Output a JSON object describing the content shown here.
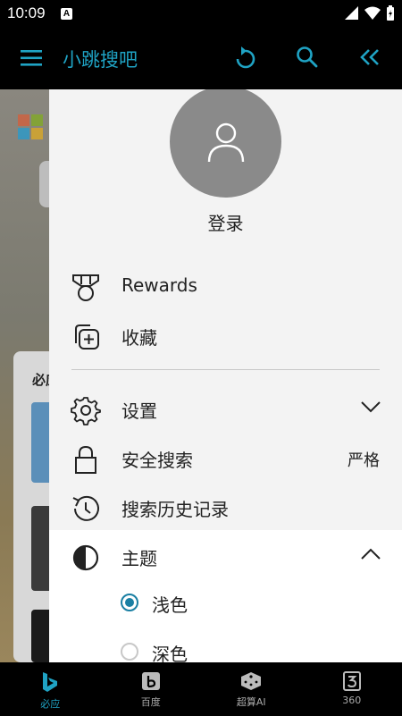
{
  "status": {
    "time": "10:09",
    "notif_icon": "A"
  },
  "appbar": {
    "title": "小跳搜吧",
    "menu_icon": "hamburger-icon",
    "refresh_icon": "refresh-icon",
    "search_icon": "search-icon",
    "collapse_icon": "double-chevron-left-icon",
    "accent": "#1fa3c4"
  },
  "background": {
    "section_label": "必应"
  },
  "drawer": {
    "login_label": "登录",
    "items": {
      "rewards": "Rewards",
      "favorites": "收藏",
      "settings": "设置",
      "safe_search": "安全搜索",
      "safe_search_value": "严格",
      "history": "搜索历史记录",
      "theme": "主题"
    },
    "theme_options": [
      {
        "label": "浅色",
        "selected": true
      },
      {
        "label": "深色",
        "selected": false
      }
    ]
  },
  "bottom_tabs": [
    {
      "label": "必应",
      "icon": "bing-icon",
      "active": true
    },
    {
      "label": "百度",
      "icon": "baidu-icon",
      "active": false
    },
    {
      "label": "超算AI",
      "icon": "dice-icon",
      "active": false
    },
    {
      "label": "360",
      "icon": "360-icon",
      "active": false
    }
  ]
}
